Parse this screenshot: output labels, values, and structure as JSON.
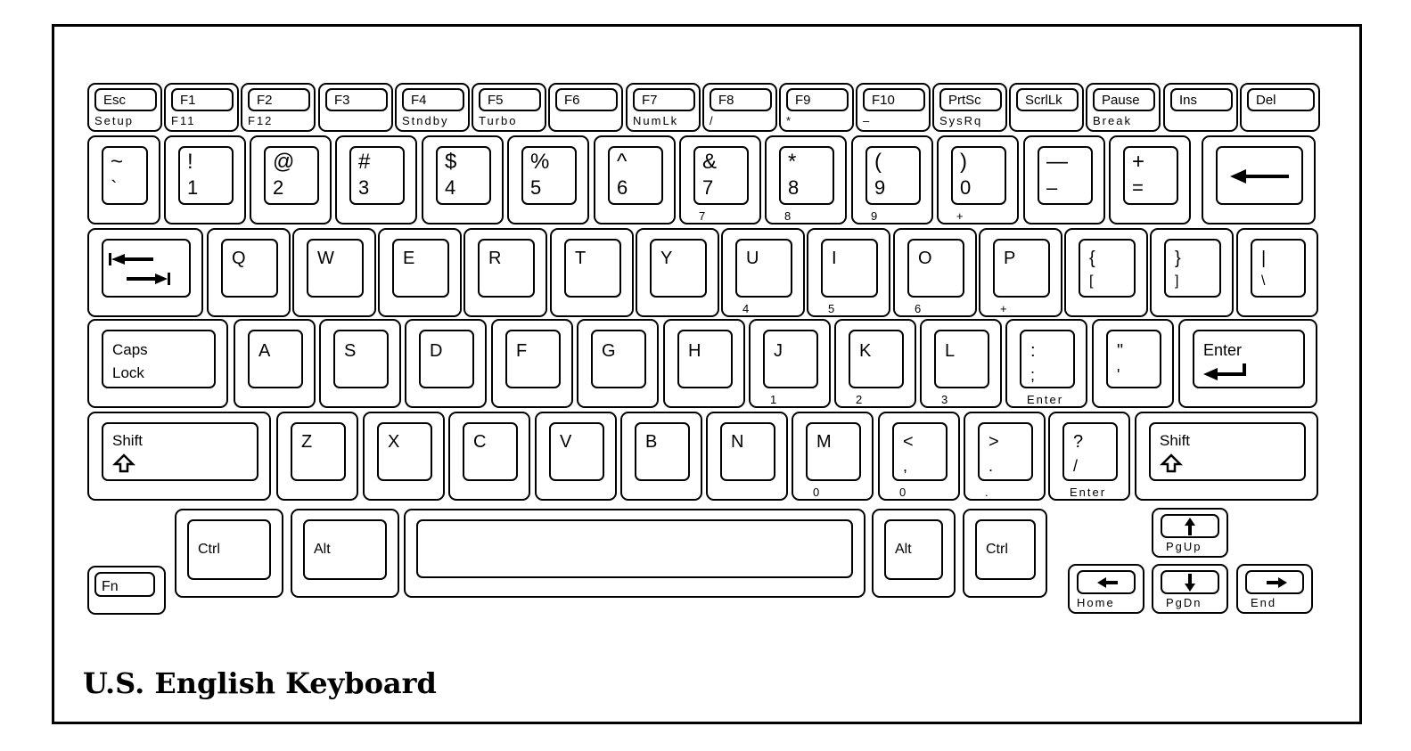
{
  "title": "U.S. English Keyboard",
  "rows": {
    "function": [
      {
        "id": "esc",
        "main": "Esc",
        "sub": "Setup"
      },
      {
        "id": "f1",
        "main": "F1",
        "sub": "F11"
      },
      {
        "id": "f2",
        "main": "F2",
        "sub": "F12"
      },
      {
        "id": "f3",
        "main": "F3",
        "sub": ""
      },
      {
        "id": "f4",
        "main": "F4",
        "sub": "Stndby"
      },
      {
        "id": "f5",
        "main": "F5",
        "sub": "Turbo"
      },
      {
        "id": "f6",
        "main": "F6",
        "sub": ""
      },
      {
        "id": "f7",
        "main": "F7",
        "sub": "NumLk"
      },
      {
        "id": "f8",
        "main": "F8",
        "sub": "/"
      },
      {
        "id": "f9",
        "main": "F9",
        "sub": "*"
      },
      {
        "id": "f10",
        "main": "F10",
        "sub": "–"
      },
      {
        "id": "prtsc",
        "main": "PrtSc",
        "sub": "SysRq"
      },
      {
        "id": "scrllk",
        "main": "ScrlLk",
        "sub": ""
      },
      {
        "id": "pause",
        "main": "Pause",
        "sub": "Break"
      },
      {
        "id": "ins",
        "main": "Ins",
        "sub": ""
      },
      {
        "id": "del",
        "main": "Del",
        "sub": ""
      }
    ],
    "number": [
      {
        "id": "tilde",
        "upper": "~",
        "lower": "`",
        "sub": ""
      },
      {
        "id": "1",
        "upper": "!",
        "lower": "1",
        "sub": ""
      },
      {
        "id": "2",
        "upper": "@",
        "lower": "2",
        "sub": ""
      },
      {
        "id": "3",
        "upper": "#",
        "lower": "3",
        "sub": ""
      },
      {
        "id": "4",
        "upper": "$",
        "lower": "4",
        "sub": ""
      },
      {
        "id": "5",
        "upper": "%",
        "lower": "5",
        "sub": ""
      },
      {
        "id": "6",
        "upper": "^",
        "lower": "6",
        "sub": ""
      },
      {
        "id": "7",
        "upper": "&",
        "lower": "7",
        "sub": "7"
      },
      {
        "id": "8",
        "upper": "*",
        "lower": "8",
        "sub": "8"
      },
      {
        "id": "9",
        "upper": "(",
        "lower": "9",
        "sub": "9"
      },
      {
        "id": "0",
        "upper": ")",
        "lower": "0",
        "sub": "+"
      },
      {
        "id": "minus",
        "upper": "—",
        "lower": "–",
        "sub": ""
      },
      {
        "id": "equals",
        "upper": "+",
        "lower": "=",
        "sub": ""
      },
      {
        "id": "backspace",
        "icon": "backspace-arrow",
        "sub": ""
      }
    ],
    "qwerty": [
      {
        "id": "tab",
        "icon": "tab-arrows",
        "sub": ""
      },
      {
        "id": "q",
        "upper": "Q",
        "sub": ""
      },
      {
        "id": "w",
        "upper": "W",
        "sub": ""
      },
      {
        "id": "e",
        "upper": "E",
        "sub": ""
      },
      {
        "id": "r",
        "upper": "R",
        "sub": ""
      },
      {
        "id": "t",
        "upper": "T",
        "sub": ""
      },
      {
        "id": "y",
        "upper": "Y",
        "sub": ""
      },
      {
        "id": "u",
        "upper": "U",
        "sub": "4"
      },
      {
        "id": "i",
        "upper": "I",
        "sub": "5"
      },
      {
        "id": "o",
        "upper": "O",
        "sub": "6"
      },
      {
        "id": "p",
        "upper": "P",
        "sub": "+"
      },
      {
        "id": "lbracket",
        "upper": "{",
        "lower": "[",
        "sub": ""
      },
      {
        "id": "rbracket",
        "upper": "}",
        "lower": "]",
        "sub": ""
      },
      {
        "id": "backslash",
        "upper": "|",
        "lower": "\\",
        "sub": ""
      }
    ],
    "home": [
      {
        "id": "capslock",
        "upper": "Caps",
        "lower": "Lock",
        "sub": ""
      },
      {
        "id": "a",
        "upper": "A",
        "sub": ""
      },
      {
        "id": "s",
        "upper": "S",
        "sub": ""
      },
      {
        "id": "d",
        "upper": "D",
        "sub": ""
      },
      {
        "id": "f",
        "upper": "F",
        "sub": ""
      },
      {
        "id": "g",
        "upper": "G",
        "sub": ""
      },
      {
        "id": "h",
        "upper": "H",
        "sub": ""
      },
      {
        "id": "j",
        "upper": "J",
        "sub": "1"
      },
      {
        "id": "k",
        "upper": "K",
        "sub": "2"
      },
      {
        "id": "l",
        "upper": "L",
        "sub": "3"
      },
      {
        "id": "semicolon",
        "upper": ":",
        "lower": ";",
        "sub": "Enter"
      },
      {
        "id": "quote",
        "upper": "\"",
        "lower": "'",
        "sub": ""
      },
      {
        "id": "enter",
        "upper": "Enter",
        "icon": "enter-arrow",
        "sub": ""
      }
    ],
    "shift": [
      {
        "id": "lshift",
        "upper": "Shift",
        "icon": "shift-arrow",
        "sub": ""
      },
      {
        "id": "z",
        "upper": "Z",
        "sub": ""
      },
      {
        "id": "x",
        "upper": "X",
        "sub": ""
      },
      {
        "id": "c",
        "upper": "C",
        "sub": ""
      },
      {
        "id": "v",
        "upper": "V",
        "sub": ""
      },
      {
        "id": "b",
        "upper": "B",
        "sub": ""
      },
      {
        "id": "n",
        "upper": "N",
        "sub": ""
      },
      {
        "id": "m",
        "upper": "M",
        "sub": "0"
      },
      {
        "id": "comma",
        "upper": "<",
        "lower": ",",
        "sub": "0"
      },
      {
        "id": "period",
        "upper": ">",
        "lower": ".",
        "sub": "."
      },
      {
        "id": "slash",
        "upper": "?",
        "lower": "/",
        "sub": "Enter"
      },
      {
        "id": "rshift",
        "upper": "Shift",
        "icon": "shift-arrow",
        "sub": ""
      }
    ],
    "bottom": [
      {
        "id": "fn",
        "upper": "Fn",
        "sub": ""
      },
      {
        "id": "lctrl",
        "upper": "Ctrl",
        "sub": ""
      },
      {
        "id": "lalt",
        "upper": "Alt",
        "sub": ""
      },
      {
        "id": "space",
        "upper": "",
        "sub": ""
      },
      {
        "id": "ralt",
        "upper": "Alt",
        "sub": ""
      },
      {
        "id": "rctrl",
        "upper": "Ctrl",
        "sub": ""
      }
    ],
    "arrows": [
      {
        "id": "up",
        "icon": "up-arrow",
        "sub": "PgUp"
      },
      {
        "id": "left",
        "icon": "left-arrow",
        "sub": "Home"
      },
      {
        "id": "down",
        "icon": "down-arrow",
        "sub": "PgDn"
      },
      {
        "id": "right",
        "icon": "right-arrow",
        "sub": "End"
      }
    ]
  }
}
